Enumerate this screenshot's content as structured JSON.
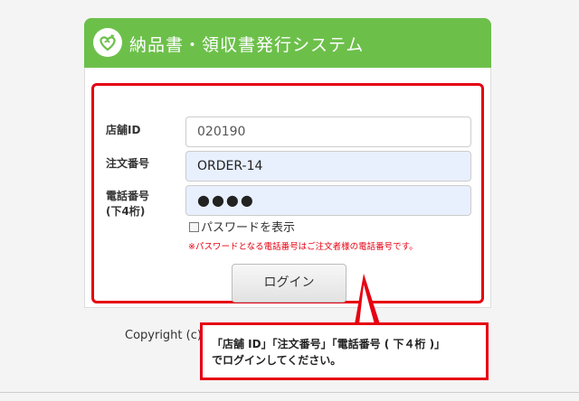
{
  "header": {
    "title": "納品書・領収書発行システム",
    "logo_icon": "heart-leaf-icon",
    "color": "#6cc04a"
  },
  "form": {
    "store_id": {
      "label": "店舗ID",
      "value": "020190"
    },
    "order_no": {
      "label": "注文番号",
      "value": "ORDER-14"
    },
    "phone": {
      "label_line1": "電話番号",
      "label_line2": "(下4桁)",
      "value": "●●●●"
    },
    "show_password_label": "パスワードを表示",
    "note": "※パスワードとなる電話番号はご注文者様の電話番号です。",
    "login_label": "ログイン"
  },
  "footer": {
    "copyright": "Copyright (c)"
  },
  "callout": {
    "line1": "「店舗 ID」「注文番号」「電話番号 ( 下４桁 )」",
    "line2": "でログインしてください。",
    "color": "#e60012"
  }
}
